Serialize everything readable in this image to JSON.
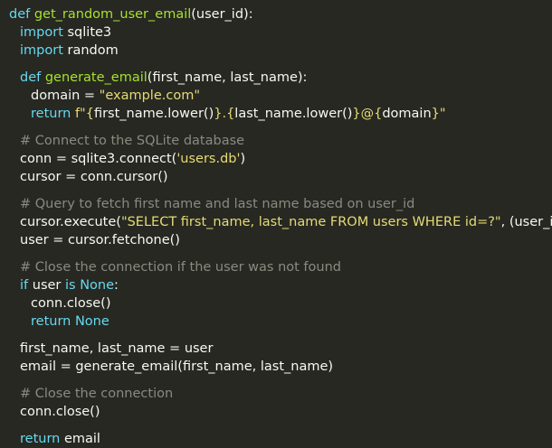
{
  "code": {
    "lines": [
      {
        "indent": 0,
        "tokens": [
          {
            "t": "kw",
            "v": "def "
          },
          {
            "t": "fn",
            "v": "get_random_user_email"
          },
          {
            "t": "tx",
            "v": "(user_id):"
          }
        ]
      },
      {
        "indent": 1,
        "tokens": [
          {
            "t": "kw",
            "v": "import "
          },
          {
            "t": "tx",
            "v": "sqlite3"
          }
        ]
      },
      {
        "indent": 1,
        "tokens": [
          {
            "t": "kw",
            "v": "import "
          },
          {
            "t": "tx",
            "v": "random"
          }
        ]
      },
      {
        "indent": 0,
        "tokens": []
      },
      {
        "indent": 1,
        "tokens": [
          {
            "t": "kw",
            "v": "def "
          },
          {
            "t": "fn",
            "v": "generate_email"
          },
          {
            "t": "tx",
            "v": "(first_name, last_name):"
          }
        ]
      },
      {
        "indent": 2,
        "tokens": [
          {
            "t": "tx",
            "v": "domain = "
          },
          {
            "t": "str",
            "v": "\"example.com\""
          }
        ]
      },
      {
        "indent": 2,
        "tokens": [
          {
            "t": "kw",
            "v": "return "
          },
          {
            "t": "str",
            "v": "f\"{"
          },
          {
            "t": "tx",
            "v": "first_name.lower()"
          },
          {
            "t": "str",
            "v": "}.{"
          },
          {
            "t": "tx",
            "v": "last_name.lower()"
          },
          {
            "t": "str",
            "v": "}@{"
          },
          {
            "t": "tx",
            "v": "domain"
          },
          {
            "t": "str",
            "v": "}\""
          }
        ]
      },
      {
        "indent": 0,
        "tokens": []
      },
      {
        "indent": 1,
        "tokens": [
          {
            "t": "cm",
            "v": "# Connect to the SQLite database"
          }
        ]
      },
      {
        "indent": 1,
        "tokens": [
          {
            "t": "tx",
            "v": "conn = sqlite3.connect("
          },
          {
            "t": "str",
            "v": "'users.db'"
          },
          {
            "t": "tx",
            "v": ")"
          }
        ]
      },
      {
        "indent": 1,
        "tokens": [
          {
            "t": "tx",
            "v": "cursor = conn.cursor()"
          }
        ]
      },
      {
        "indent": 0,
        "tokens": []
      },
      {
        "indent": 1,
        "tokens": [
          {
            "t": "cm",
            "v": "# Query to fetch first name and last name based on user_id"
          }
        ]
      },
      {
        "indent": 1,
        "tokens": [
          {
            "t": "tx",
            "v": "cursor.execute("
          },
          {
            "t": "str",
            "v": "\"SELECT first_name, last_name FROM users WHERE id=?\""
          },
          {
            "t": "tx",
            "v": ", (user_id,))"
          }
        ]
      },
      {
        "indent": 1,
        "tokens": [
          {
            "t": "tx",
            "v": "user = cursor.fetchone()"
          }
        ]
      },
      {
        "indent": 0,
        "tokens": []
      },
      {
        "indent": 1,
        "tokens": [
          {
            "t": "cm",
            "v": "# Close the connection if the user was not found"
          }
        ]
      },
      {
        "indent": 1,
        "tokens": [
          {
            "t": "kw",
            "v": "if "
          },
          {
            "t": "tx",
            "v": "user "
          },
          {
            "t": "kw",
            "v": "is None"
          },
          {
            "t": "tx",
            "v": ":"
          }
        ]
      },
      {
        "indent": 2,
        "tokens": [
          {
            "t": "tx",
            "v": "conn.close()"
          }
        ]
      },
      {
        "indent": 2,
        "tokens": [
          {
            "t": "kw",
            "v": "return None"
          }
        ]
      },
      {
        "indent": 0,
        "tokens": []
      },
      {
        "indent": 1,
        "tokens": [
          {
            "t": "tx",
            "v": "first_name, last_name = user"
          }
        ]
      },
      {
        "indent": 1,
        "tokens": [
          {
            "t": "tx",
            "v": "email = generate_email(first_name, last_name)"
          }
        ]
      },
      {
        "indent": 0,
        "tokens": []
      },
      {
        "indent": 1,
        "tokens": [
          {
            "t": "cm",
            "v": "# Close the connection"
          }
        ]
      },
      {
        "indent": 1,
        "tokens": [
          {
            "t": "tx",
            "v": "conn.close()"
          }
        ]
      },
      {
        "indent": 0,
        "tokens": []
      },
      {
        "indent": 1,
        "tokens": [
          {
            "t": "kw",
            "v": "return "
          },
          {
            "t": "tx",
            "v": "email"
          }
        ]
      }
    ]
  },
  "colors": {
    "background": "#272822",
    "keyword": "#66d9ef",
    "function": "#a6e22e",
    "string": "#e6db74",
    "comment": "#8a8a80",
    "text": "#f8f8f2"
  }
}
